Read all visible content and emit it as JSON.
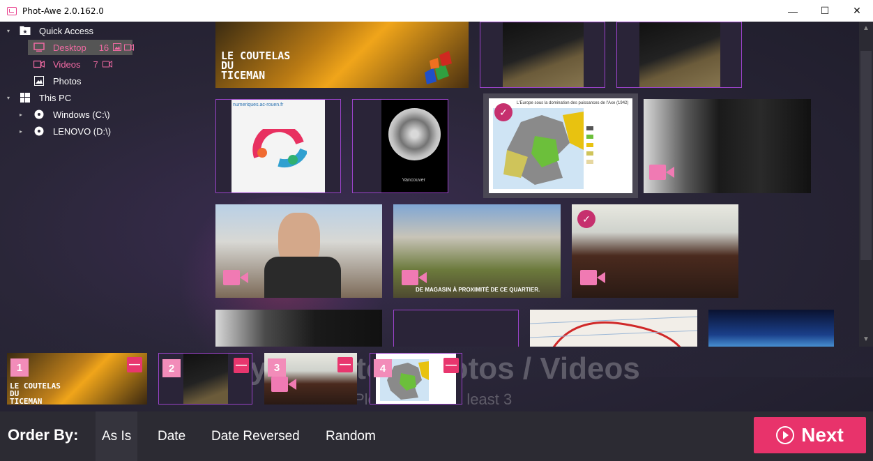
{
  "window": {
    "title": "Phot-Awe 2.0.162.0",
    "minimize": "—",
    "maximize": "☐",
    "close": "✕"
  },
  "sidebar": {
    "quick_access": "Quick Access",
    "desktop": "Desktop",
    "desktop_count": "16",
    "videos": "Videos",
    "videos_count": "7",
    "photos": "Photos",
    "this_pc": "This PC",
    "drive_c": "Windows (C:\\)",
    "drive_d": "LENOVO (D:\\)"
  },
  "thumbs": {
    "coutelas_line1": "LE COUTELAS",
    "coutelas_line2": "DU",
    "coutelas_line3": "TICEMAN",
    "numeriques": "numeriques.ac-rouen.fr",
    "vancouver": "Vancouver",
    "map_title": "L'Europe sous la domination des puissances de l'Axe (1942)",
    "garden_caption": "DE MAGASIN À PROXIMITÉ DE CE QUARTIER."
  },
  "heading": {
    "title": "My Selected Photos / Videos",
    "subtitle": "Please select at least 3"
  },
  "strip": {
    "items": [
      {
        "num": "1",
        "remove": "—"
      },
      {
        "num": "2",
        "remove": "—"
      },
      {
        "num": "3",
        "remove": "—"
      },
      {
        "num": "4",
        "remove": "—"
      }
    ]
  },
  "bottom": {
    "order_by": "Order By:",
    "as_is": "As Is",
    "date": "Date",
    "date_reversed": "Date Reversed",
    "random": "Random",
    "next": "Next"
  },
  "colors": {
    "accent": "#e8336b",
    "highlight": "#f06aa3",
    "outline": "#9a43c9"
  }
}
